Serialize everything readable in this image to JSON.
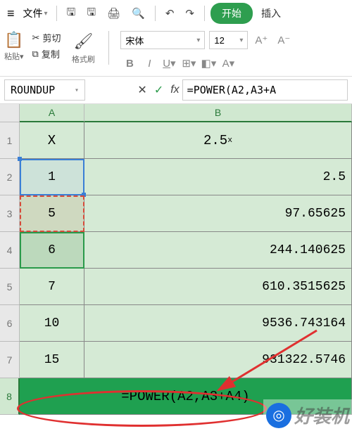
{
  "menu": {
    "file": "文件",
    "start": "开始",
    "insert": "插入"
  },
  "clipboard": {
    "paste": "粘贴",
    "cut": "剪切",
    "copy": "复制",
    "format_painter": "格式刷"
  },
  "font": {
    "name": "宋体",
    "size": "12",
    "bold": "B",
    "italic": "I",
    "underline": "U"
  },
  "namebox": "ROUNDUP",
  "formula_bar": "=POWER(A2,A3+A",
  "fx_cancel": "✕",
  "fx_confirm": "✓",
  "fx_label": "fx",
  "columns": {
    "A": "A",
    "B": "B"
  },
  "rows": [
    "1",
    "2",
    "3",
    "4",
    "5",
    "6",
    "7",
    "8"
  ],
  "cells": {
    "A1": "X",
    "B1_base": "2.5",
    "B1_exp": "x",
    "A2": "1",
    "B2": "2.5",
    "A3": "5",
    "B3": "97.65625",
    "A4": "6",
    "B4": "244.140625",
    "A5": "7",
    "B5": "610.3515625",
    "A6": "10",
    "B6": "9536.743164",
    "A7": "15",
    "B7": "931322.5746",
    "edit8": "=POWER(A2,A3+A4)"
  },
  "watermark": "好装机",
  "chart_data": {
    "type": "table",
    "title": "2.5^x",
    "columns": [
      "X",
      "2.5^x"
    ],
    "rows": [
      [
        1,
        2.5
      ],
      [
        5,
        97.65625
      ],
      [
        6,
        244.140625
      ],
      [
        7,
        610.3515625
      ],
      [
        10,
        9536.743164
      ],
      [
        15,
        931322.5746
      ]
    ],
    "editing_formula": "=POWER(A2,A3+A4)"
  }
}
